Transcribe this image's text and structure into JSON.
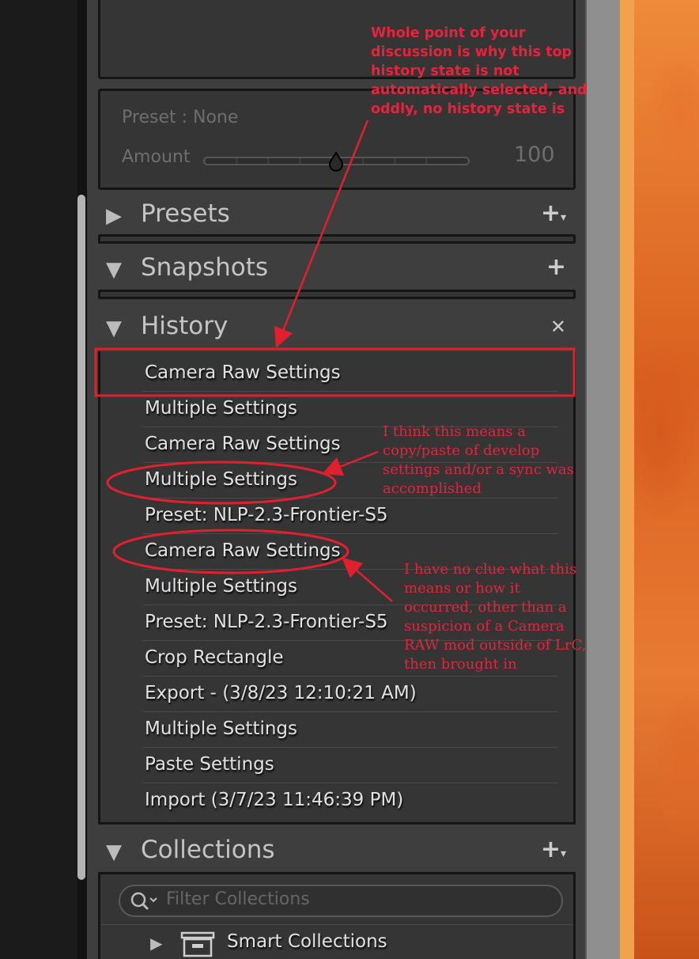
{
  "develop": {
    "preset_label": "Preset : None",
    "amount_label": "Amount",
    "amount_value": "100"
  },
  "panels": {
    "presets": {
      "title": "Presets",
      "action": "+"
    },
    "snapshots": {
      "title": "Snapshots",
      "action": "+"
    },
    "history": {
      "title": "History",
      "action": "✕"
    },
    "collections": {
      "title": "Collections",
      "action": "+"
    }
  },
  "history": {
    "items": [
      "Camera Raw Settings",
      "Multiple Settings",
      "Camera Raw Settings",
      "Multiple Settings",
      "Preset: NLP-2.3-Frontier-S5",
      "Camera Raw Settings",
      "Multiple Settings",
      "Preset: NLP-2.3-Frontier-S5",
      "Crop Rectangle",
      "Export -  (3/8/23 12:10:21 AM)",
      "Multiple Settings",
      "Paste Settings",
      "Import (3/7/23 11:46:39 PM)"
    ]
  },
  "collections": {
    "filter_placeholder": "Filter Collections",
    "smart_collections_label": "Smart Collections"
  },
  "annotations": {
    "top_note": [
      "Whole point of your",
      "discussion is why this top",
      "history state is not",
      "automatically selected, and",
      "oddly, no history state is"
    ],
    "copy_paste_note": [
      "I think this means a",
      "copy/paste of develop",
      "settings and/or a sync was",
      "accomplished"
    ],
    "camera_raw_note": [
      "I have no clue what this",
      "means or how it",
      "occurred, other than a",
      "suspicion of a Camera",
      "RAW mod outside of LrC,",
      "then brought in"
    ],
    "color": "#e0202f"
  },
  "icons": {
    "collapsed_triangle": "triangle-right-icon",
    "expanded_triangle": "triangle-down-icon",
    "clear_history": "close-icon",
    "search": "search-icon",
    "smart_collection": "smart-collection-icon"
  }
}
